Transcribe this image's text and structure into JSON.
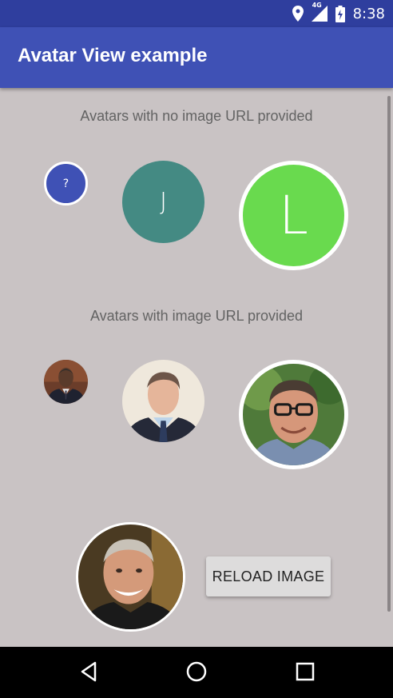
{
  "status_bar": {
    "time": "8:38",
    "network_label": "4G",
    "icons": [
      "location-icon",
      "signal-icon",
      "battery-icon"
    ],
    "background": "#2f3e9e"
  },
  "app_bar": {
    "title": "Avatar View example",
    "background": "#3f51b5"
  },
  "content": {
    "background": "#c9c3c4",
    "section_no_url": {
      "label": "Avatars with no image URL provided",
      "avatars": [
        {
          "letter": "?",
          "color": "#3f51b5",
          "border": "white"
        },
        {
          "letter": "J",
          "color": "#448a83",
          "border": "none"
        },
        {
          "letter": "L",
          "color": "#69da4e",
          "border": "white"
        }
      ]
    },
    "section_with_url": {
      "label": "Avatars with image URL provided",
      "avatars": [
        {
          "photo": "man-dark-suit-photo",
          "border": "none"
        },
        {
          "photo": "man-blue-shirt-tie-photo",
          "border": "none"
        },
        {
          "photo": "man-glasses-outdoors-photo",
          "border": "white"
        }
      ]
    },
    "bottom": {
      "avatar": {
        "photo": "smiling-man-photo",
        "border": "white"
      },
      "reload_button_label": "RELOAD IMAGE"
    }
  },
  "nav_bar": {
    "icons": [
      "back-icon",
      "home-icon",
      "recents-icon"
    ]
  }
}
